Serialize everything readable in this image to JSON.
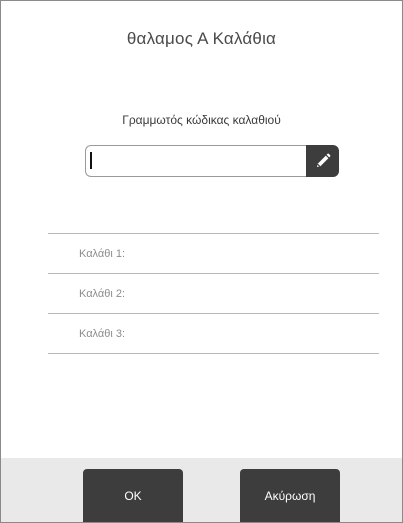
{
  "dialog": {
    "title": "θαλαμος Α Καλάθια"
  },
  "barcode": {
    "label": "Γραμμωτός κώδικας καλαθιού",
    "value": "",
    "placeholder": "",
    "edit_icon": "pencil-icon"
  },
  "baskets": [
    {
      "label": "Καλάθι 1:"
    },
    {
      "label": "Καλάθι 2:"
    },
    {
      "label": "Καλάθι 3:"
    }
  ],
  "footer": {
    "ok_label": "OK",
    "cancel_label": "Ακύρωση"
  },
  "colors": {
    "button_bg": "#3d3d3d",
    "footer_bg": "#e9e9e9",
    "divider": "#b8b8b8"
  }
}
